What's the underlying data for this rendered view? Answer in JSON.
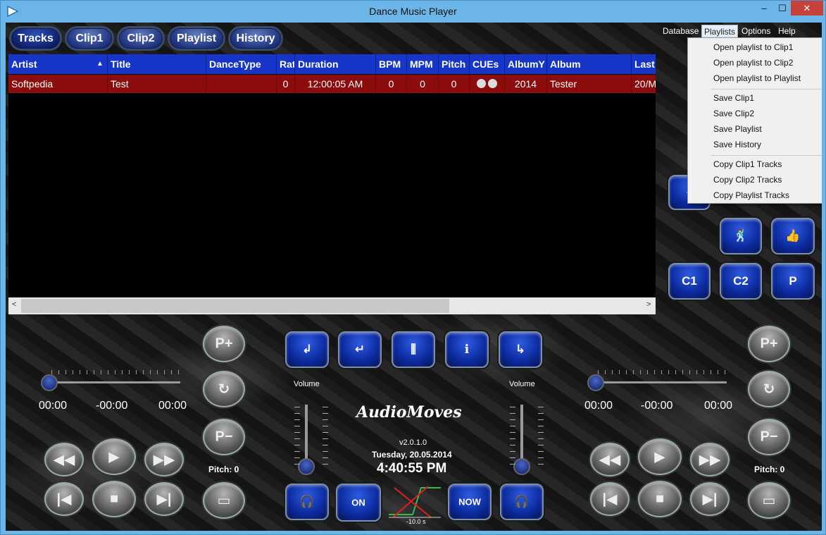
{
  "window": {
    "title": "Dance Music Player",
    "minimize": "–",
    "maximize": "☐",
    "close": "✕"
  },
  "tabs": [
    "Tracks",
    "Clip1",
    "Clip2",
    "Playlist",
    "History"
  ],
  "menubar": [
    "Database",
    "Playlists",
    "Options",
    "Help"
  ],
  "playlists_menu": {
    "group1": [
      "Open playlist to Clip1",
      "Open playlist to Clip2",
      "Open playlist to Playlist"
    ],
    "group2": [
      "Save Clip1",
      "Save Clip2",
      "Save Playlist",
      "Save History"
    ],
    "group3": [
      "Copy Clip1 Tracks",
      "Copy Clip2 Tracks",
      "Copy Playlist Tracks"
    ]
  },
  "table": {
    "columns": [
      "Artist",
      "Title",
      "DanceType",
      "Rat",
      "Duration",
      "BPM",
      "MPM",
      "Pitch",
      "CUEs",
      "AlbumY",
      "Album",
      "Last"
    ],
    "sort_indicator": "▲",
    "rows": [
      [
        "Softpedia",
        "Test",
        "",
        "0",
        "12:00:05 AM",
        "0",
        "0",
        "0",
        "",
        "2014",
        "Tester",
        "20/M"
      ]
    ]
  },
  "left_deck": {
    "time_elapsed": "00:00",
    "time_remaining": "-00:00",
    "time_total": "00:00",
    "pitch_label": "Pitch: 0"
  },
  "right_deck": {
    "time_elapsed": "00:00",
    "time_remaining": "-00:00",
    "time_total": "00:00",
    "pitch_label": "Pitch: 0"
  },
  "center": {
    "volume_left": "Volume",
    "volume_right": "Volume",
    "logo": "AudioMoves",
    "version": "v2.0.1.0",
    "date": "Tuesday, 20.05.2014",
    "clock": "4:40:55 PM",
    "fade_time": "-10.0 s",
    "on_label": "ON",
    "now_label": "NOW"
  },
  "side_buttons": {
    "c1": "C1",
    "c2": "C2",
    "p": "P"
  },
  "colors": {
    "header_blue": "#1736c9",
    "selected_row": "#8c0b0b",
    "titlebar": "#6cb5e8"
  }
}
